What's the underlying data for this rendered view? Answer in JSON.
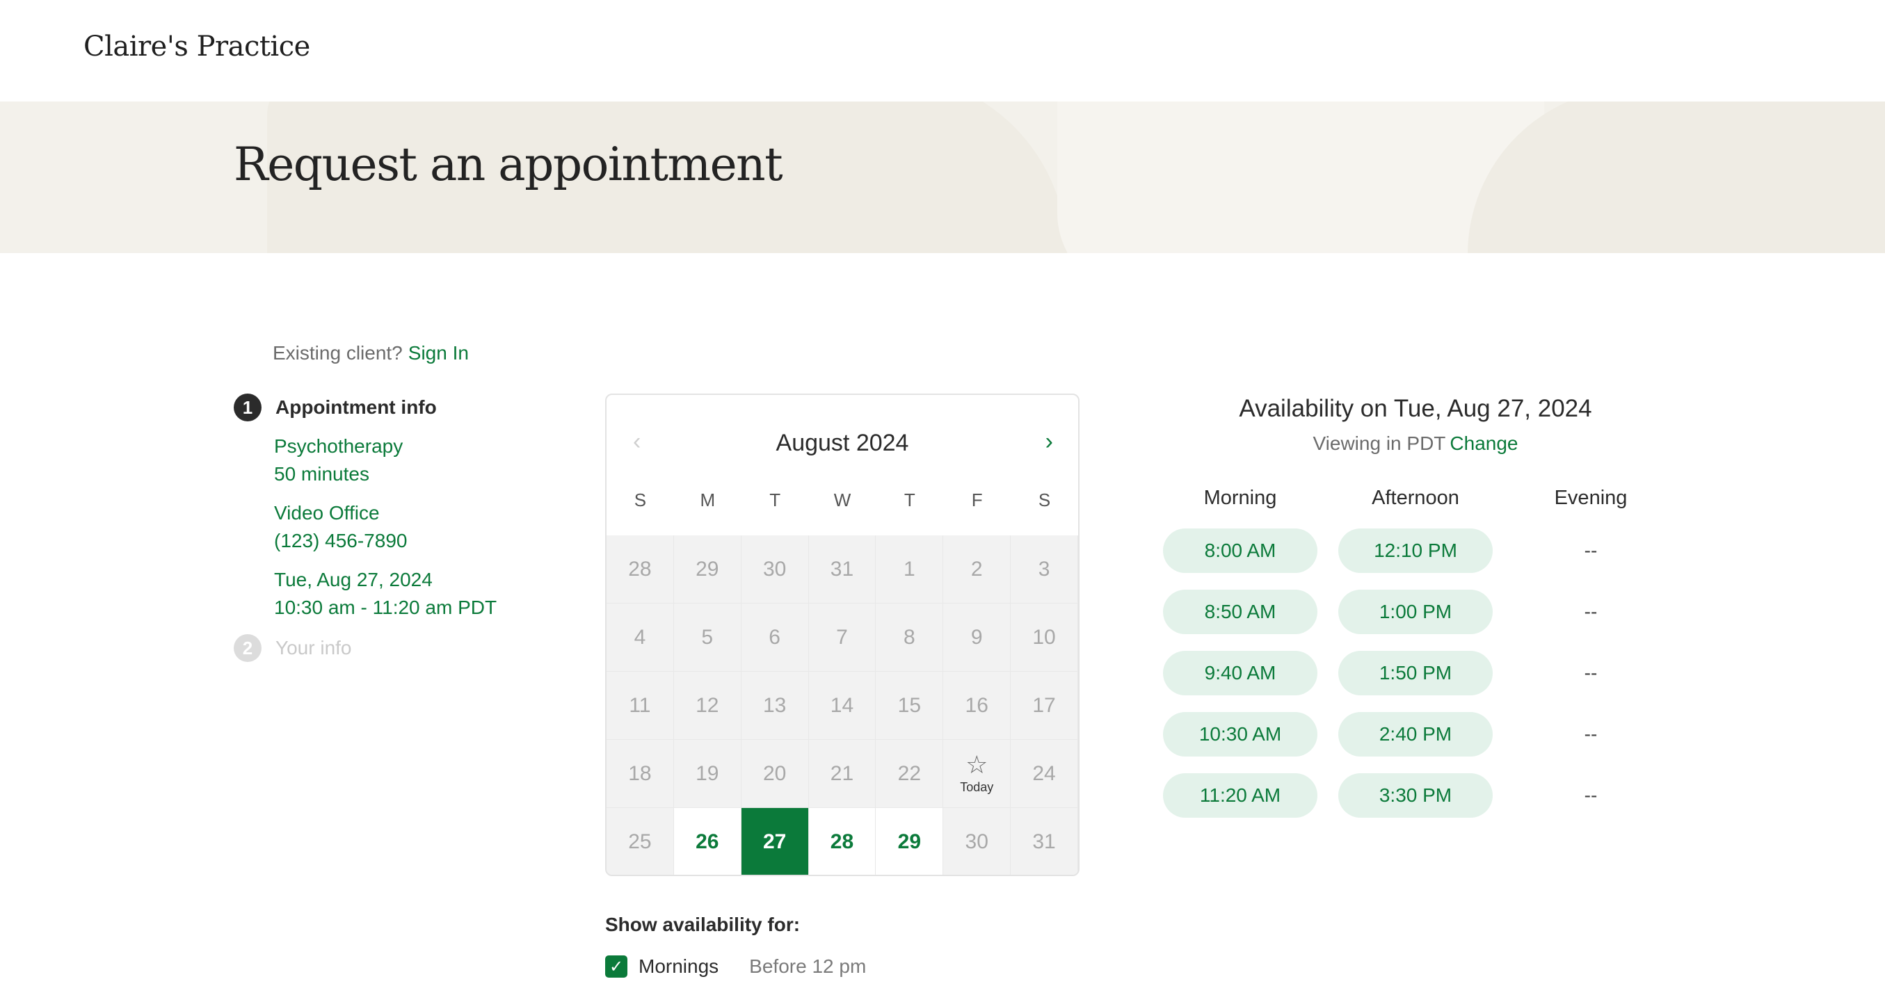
{
  "brand": "Claire's Practice",
  "hero": {
    "title": "Request an appointment"
  },
  "existing": {
    "prompt": "Existing client?",
    "sign_in": "Sign In"
  },
  "steps": [
    {
      "number": "1",
      "title": "Appointment info"
    },
    {
      "number": "2",
      "title": "Your info"
    }
  ],
  "appointment": {
    "service": "Psychotherapy",
    "duration": "50 minutes",
    "location": "Video Office",
    "phone": "(123) 456-7890",
    "date": "Tue, Aug 27, 2024",
    "time": "10:30 am - 11:20 am PDT"
  },
  "calendar": {
    "month": "August 2024",
    "prev_icon": "chevron-left-icon",
    "next_icon": "chevron-right-icon",
    "weekdays": [
      "S",
      "M",
      "T",
      "W",
      "T",
      "F",
      "S"
    ],
    "today_label": "Today",
    "today_icon": "star-icon",
    "days": [
      {
        "d": "28",
        "s": "off"
      },
      {
        "d": "29",
        "s": "off"
      },
      {
        "d": "30",
        "s": "off"
      },
      {
        "d": "31",
        "s": "off"
      },
      {
        "d": "1",
        "s": "off"
      },
      {
        "d": "2",
        "s": "off"
      },
      {
        "d": "3",
        "s": "off"
      },
      {
        "d": "4",
        "s": "off"
      },
      {
        "d": "5",
        "s": "off"
      },
      {
        "d": "6",
        "s": "off"
      },
      {
        "d": "7",
        "s": "off"
      },
      {
        "d": "8",
        "s": "off"
      },
      {
        "d": "9",
        "s": "off"
      },
      {
        "d": "10",
        "s": "off"
      },
      {
        "d": "11",
        "s": "off"
      },
      {
        "d": "12",
        "s": "off"
      },
      {
        "d": "13",
        "s": "off"
      },
      {
        "d": "14",
        "s": "off"
      },
      {
        "d": "15",
        "s": "off"
      },
      {
        "d": "16",
        "s": "off"
      },
      {
        "d": "17",
        "s": "off"
      },
      {
        "d": "18",
        "s": "off"
      },
      {
        "d": "19",
        "s": "off"
      },
      {
        "d": "20",
        "s": "off"
      },
      {
        "d": "21",
        "s": "off"
      },
      {
        "d": "22",
        "s": "off"
      },
      {
        "d": "",
        "s": "today"
      },
      {
        "d": "24",
        "s": "off"
      },
      {
        "d": "25",
        "s": "off"
      },
      {
        "d": "26",
        "s": "avail"
      },
      {
        "d": "27",
        "s": "selected"
      },
      {
        "d": "28",
        "s": "avail"
      },
      {
        "d": "29",
        "s": "avail"
      },
      {
        "d": "30",
        "s": "off"
      },
      {
        "d": "31",
        "s": "off"
      }
    ]
  },
  "availability": {
    "title": "Availability on Tue, Aug 27, 2024",
    "viewing": "Viewing in PDT",
    "change": "Change",
    "columns": [
      {
        "name": "Morning",
        "slots": [
          "8:00 AM",
          "8:50 AM",
          "9:40 AM",
          "10:30 AM",
          "11:20 AM"
        ]
      },
      {
        "name": "Afternoon",
        "slots": [
          "12:10 PM",
          "1:00 PM",
          "1:50 PM",
          "2:40 PM",
          "3:30 PM"
        ]
      },
      {
        "name": "Evening",
        "slots": [
          "--",
          "--",
          "--",
          "--",
          "--"
        ]
      }
    ]
  },
  "show_availability": {
    "label": "Show availability for:",
    "options": [
      {
        "label": "Mornings",
        "desc": "Before 12 pm",
        "checked": true
      }
    ]
  },
  "colors": {
    "accent": "#0b7a3a",
    "slot_bg": "#e3f2ea",
    "hero_bg": "#f3f1eb"
  }
}
